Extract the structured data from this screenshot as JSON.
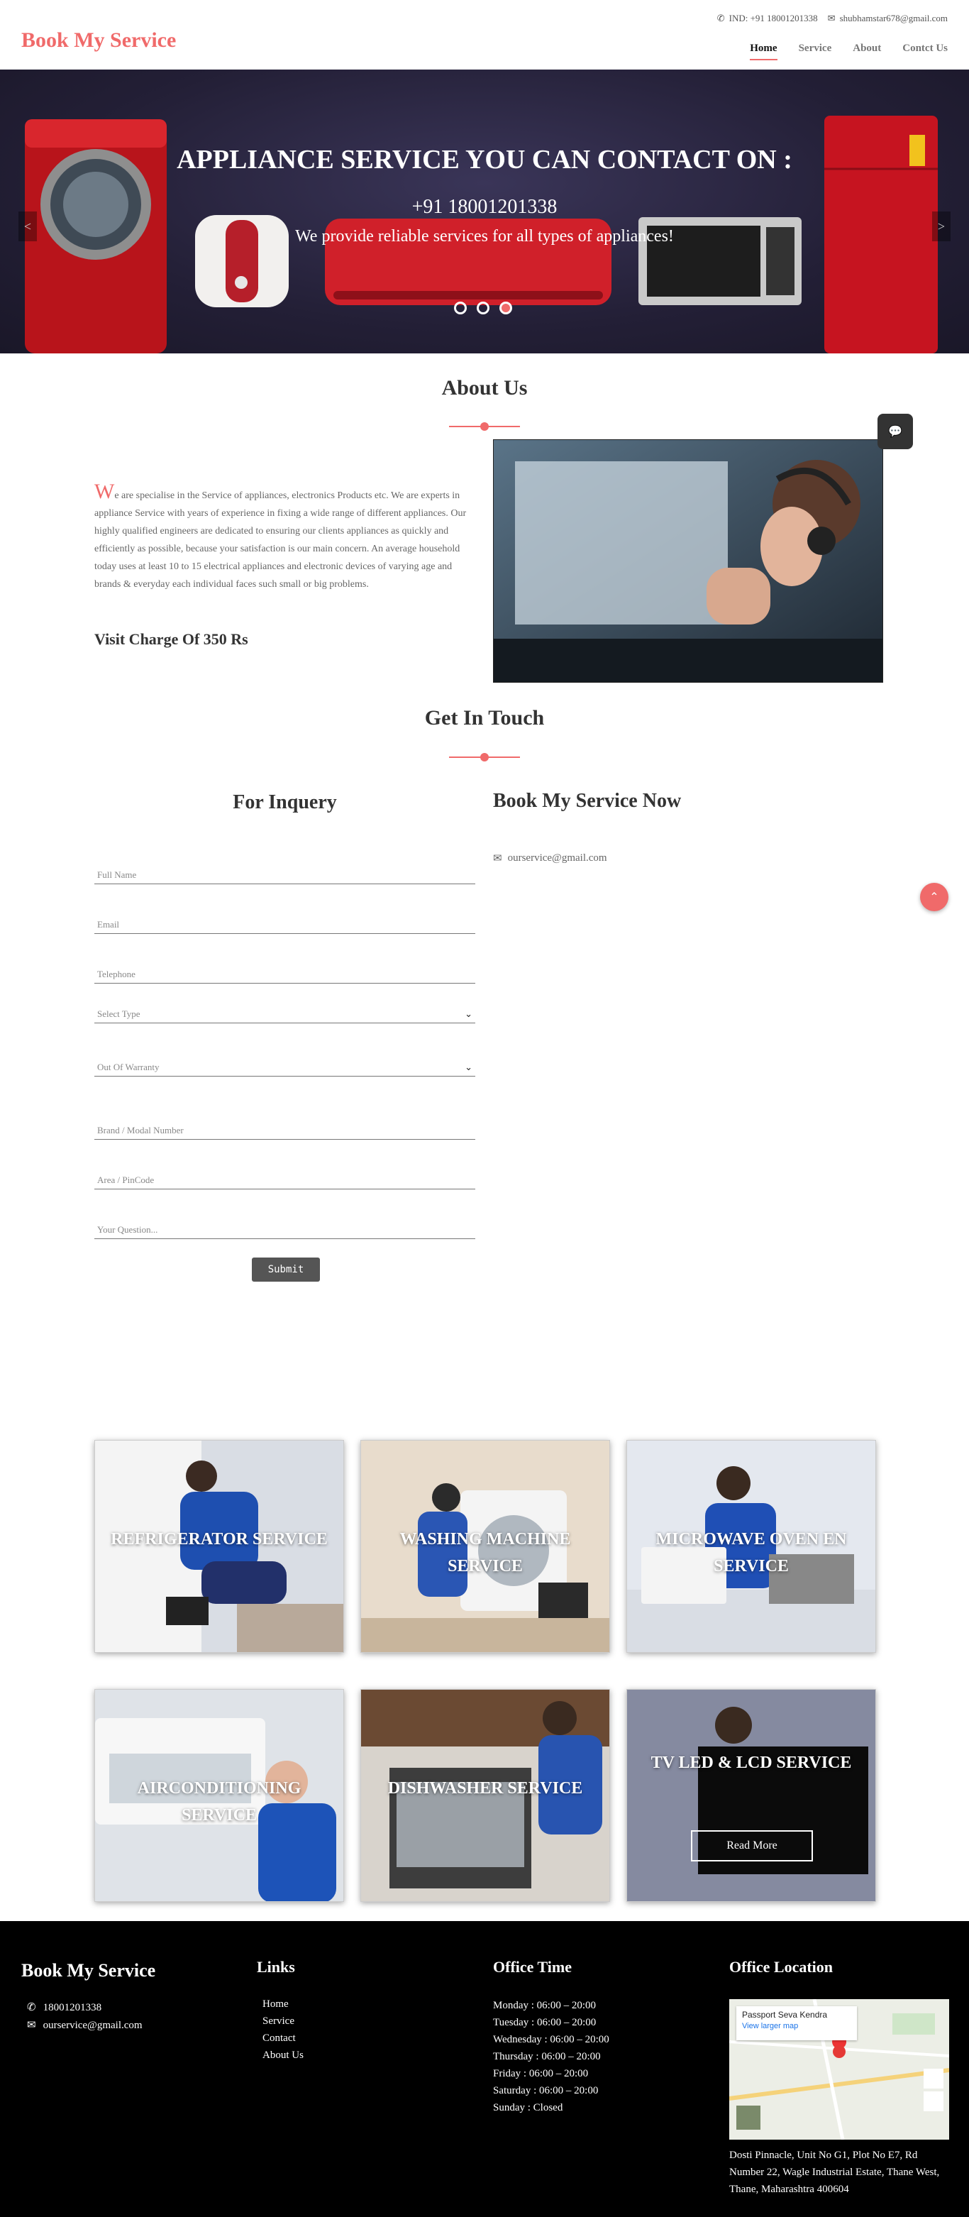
{
  "header": {
    "brand": "Book My Service",
    "phone": "IND: +91 18001201338",
    "email": "shubhamstar678@gmail.com",
    "nav": [
      "Home",
      "Service",
      "About",
      "Contct Us"
    ]
  },
  "hero": {
    "title": "APPLIANCE SERVICE YOU CAN CONTACT ON :",
    "phone": "+91 18001201338",
    "description": "We provide reliable services for all types of appliances!",
    "prev": "<",
    "next": ">"
  },
  "about": {
    "title": "About Us",
    "drop_letter": "W",
    "text": "e are specialise in the Service of appliances, electronics Products etc. We are experts in appliance Service with years of experience in fixing a wide range of different appliances. Our highly qualified engineers are dedicated to ensuring our clients appliances as quickly and efficiently as possible, because your satisfaction is our main concern. An average household today uses at least 10 to 15 electrical appliances and electronic devices of varying age and brands & everyday each individual faces such small or big problems.",
    "visit_charge": "Visit Charge Of 350 Rs"
  },
  "contact": {
    "title": "Get In Touch",
    "inquiry_title": "For Inquery",
    "book_title": "Book My Service Now",
    "book_email": "ourservice@gmail.com",
    "fields": {
      "full_name": "Full Name",
      "email": "Email",
      "telephone": "Telephone",
      "select_type": "Select Type",
      "warranty": "Out Of Warranty",
      "brand_model": "Brand / Modal Number",
      "area": "Area / PinCode",
      "question": "Your Question..."
    },
    "submit": "Submit"
  },
  "services": [
    {
      "label": "REFRIGERATOR SERVICE"
    },
    {
      "label": "WASHING MACHINE SERVICE"
    },
    {
      "label": "MICROWAVE OVEN EN SERVICE"
    },
    {
      "label": "AIRCONDITIONING SERVICE"
    },
    {
      "label": "DISHWASHER SERVICE"
    },
    {
      "label": "TV LED & LCD SERVICE",
      "button": "Read More"
    }
  ],
  "footer": {
    "brand": "Book My Service",
    "phone": "18001201338",
    "email": "ourservice@gmail.com",
    "links_title": "Links",
    "links": [
      "Home",
      "Service",
      "Contact",
      "About Us"
    ],
    "office_time_title": "Office Time",
    "hours": [
      "Monday : 06:00 – 20:00",
      "Tuesday : 06:00 – 20:00",
      "Wednesday : 06:00 – 20:00",
      "Thursday : 06:00 – 20:00",
      "Friday : 06:00 – 20:00",
      "Saturday : 06:00 – 20:00",
      "Sunday : Closed"
    ],
    "location_title": "Office Location",
    "map_place": "Passport Seva Kendra",
    "map_link": "View larger map",
    "address": "Dosti Pinnacle, Unit No G1, Plot No E7, Rd Number 22, Wagle Industrial Estate, Thane West, Thane, Maharashtra 400604"
  },
  "colors": {
    "accent": "#f06a6a",
    "dark": "#000000",
    "hero_bg": "#231f36"
  }
}
